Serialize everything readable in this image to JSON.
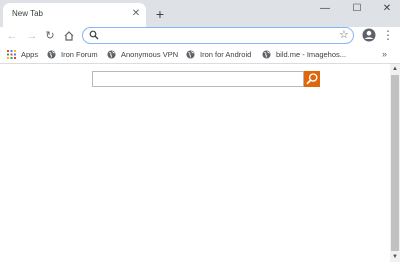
{
  "tab": {
    "title": "New Tab",
    "close": "✕"
  },
  "tabstrip": {
    "new_tab": "+"
  },
  "window": {
    "minimize": "—",
    "maximize": "☐",
    "close": "✕"
  },
  "toolbar": {
    "back": "←",
    "forward": "→",
    "reload": "↻",
    "home": "⌂",
    "menu": "⋮"
  },
  "omnibox": {
    "value": "",
    "placeholder": ""
  },
  "bookmarks": {
    "apps_label": "Apps",
    "items": [
      {
        "label": "Iron Forum",
        "icon": "globe-icon"
      },
      {
        "label": "Anonymous VPN",
        "icon": "globe-icon"
      },
      {
        "label": "Iron for Android",
        "icon": "globe-icon"
      },
      {
        "label": "bild.me - Imagehos...",
        "icon": "globe-icon"
      }
    ],
    "more": "»"
  },
  "content": {
    "search_value": "",
    "search_button_color": "#e0660c"
  },
  "scrollbar": {
    "up": "▲",
    "down": "▼"
  }
}
